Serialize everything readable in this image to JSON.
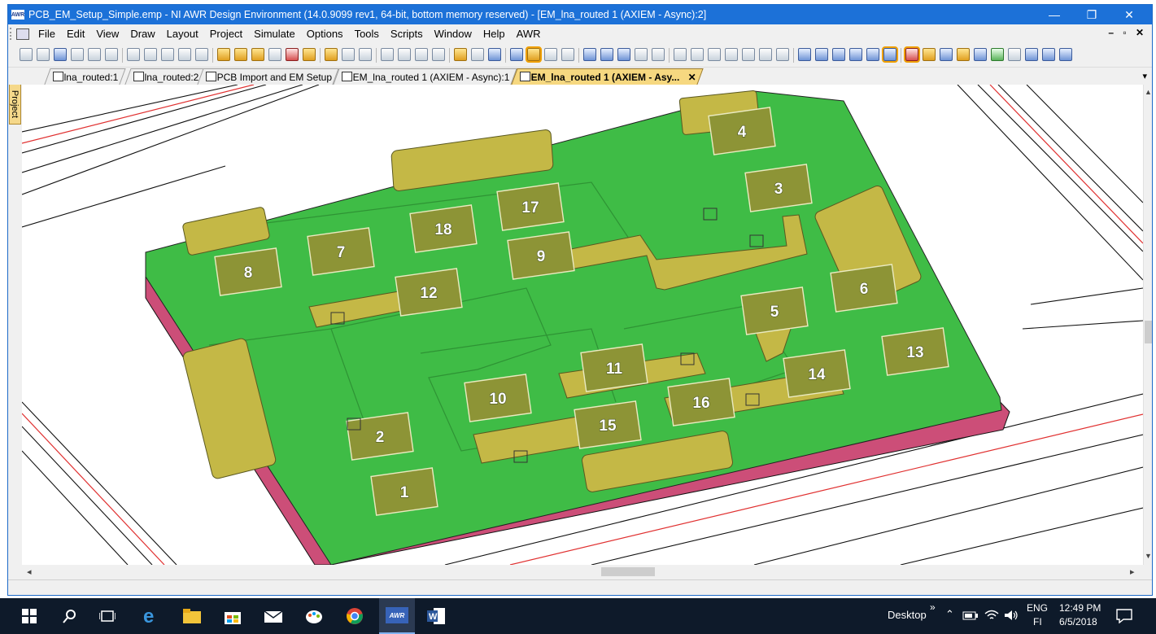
{
  "window": {
    "title": "PCB_EM_Setup_Simple.emp - NI AWR Design Environment (14.0.9099 rev1, 64-bit, bottom memory reserved) - [EM_lna_routed 1 (AXIEM - Async):2]",
    "app_badge": "AWR",
    "controls": {
      "minimize": "—",
      "restore": "❐",
      "close": "✕"
    }
  },
  "menu": {
    "items": [
      "File",
      "Edit",
      "View",
      "Draw",
      "Layout",
      "Project",
      "Simulate",
      "Options",
      "Tools",
      "Scripts",
      "Window",
      "Help",
      "AWR"
    ],
    "mdi_controls": "– ▫ ✕"
  },
  "sidebar": {
    "project_tab": "Project"
  },
  "tabs": [
    {
      "label": "lna_routed:1",
      "active": false
    },
    {
      "label": "lna_routed:2",
      "active": false
    },
    {
      "label": "PCB Import and EM Setup",
      "active": false
    },
    {
      "label": "EM_lna_routed 1 (AXIEM - Async):1",
      "active": false
    },
    {
      "label": "EM_lna_routed 1 (AXIEM - Asy...",
      "active": true
    }
  ],
  "tab_close": "✕",
  "tab_dropdown": "▾",
  "layout": {
    "labels": [
      "1",
      "2",
      "3",
      "4",
      "5",
      "6",
      "7",
      "8",
      "9",
      "10",
      "11",
      "12",
      "13",
      "14",
      "15",
      "16",
      "17",
      "18"
    ],
    "colors": {
      "board": "#3fbc46",
      "board_edge": "#2e8e33",
      "substrate": "#cc4e78",
      "pad": "#a6a83c",
      "pad_dark": "#8d9436",
      "trace": "#c4b846",
      "outline": "#000000",
      "red_line": "#e03030"
    }
  },
  "taskbar": {
    "desktop_label": "Desktop",
    "chevron": "»",
    "lang": "ENG",
    "region": "FI",
    "time": "12:49 PM",
    "date": "6/5/2018",
    "awr_label": "AWR"
  }
}
